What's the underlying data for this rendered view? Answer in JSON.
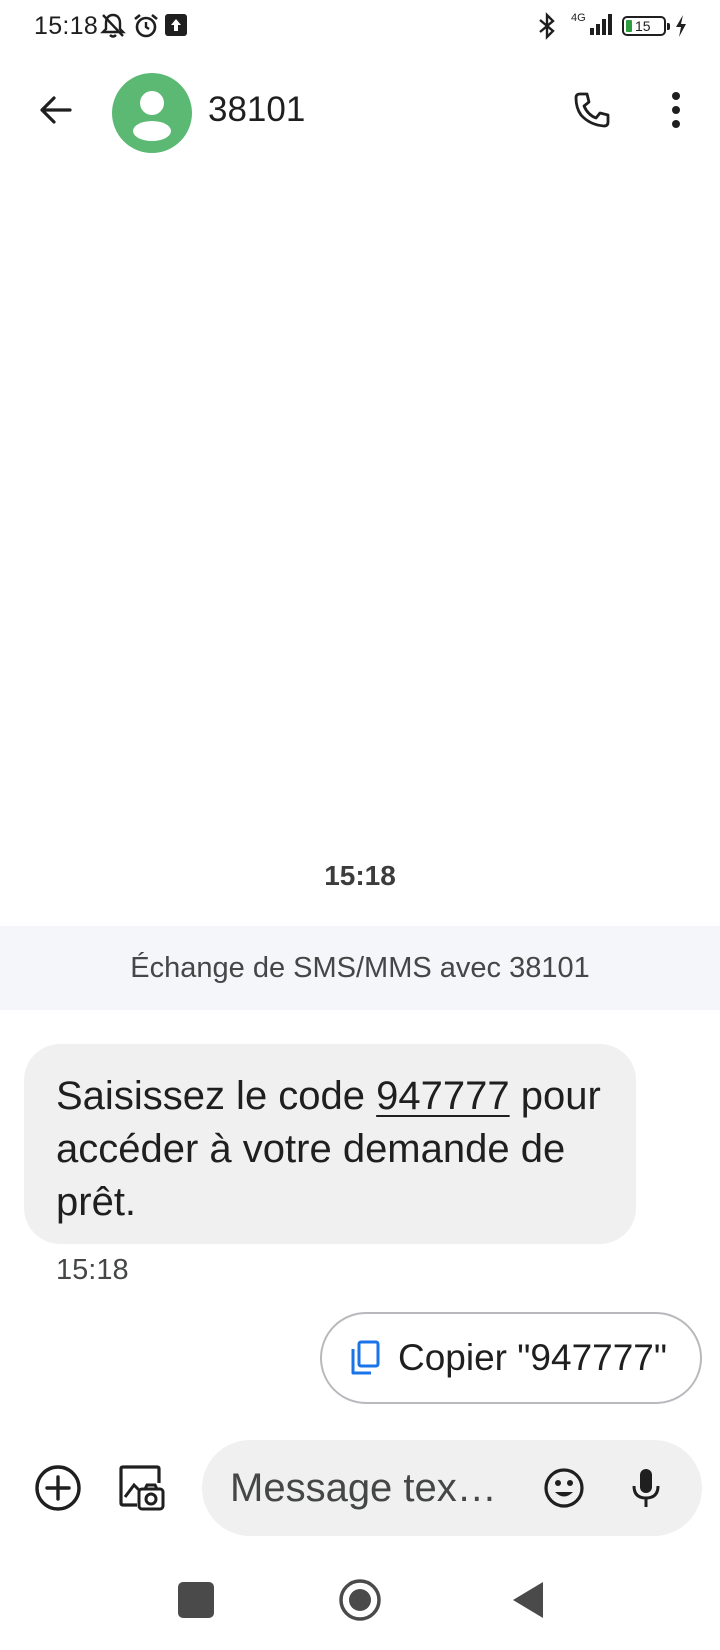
{
  "status_bar": {
    "time": "15:18",
    "battery_level": "15",
    "network": "4G",
    "icons": [
      "notifications-off-icon",
      "alarm-icon",
      "upload-icon",
      "bluetooth-icon",
      "signal-icon",
      "battery-icon",
      "charging-icon"
    ]
  },
  "app_bar": {
    "contact_name": "38101",
    "avatar_color": "#5bb974",
    "icons": [
      "back-arrow-icon",
      "phone-icon",
      "more-vert-icon"
    ]
  },
  "conversation": {
    "time_header": "15:18",
    "exchange_banner": "Échange de SMS/MMS avec 38101",
    "message": {
      "text_before": "Saisissez le code ",
      "code": "947777",
      "text_after": " pour accéder à votre demande de prêt.",
      "time": "15:18"
    },
    "copy_suggestion": "Copier \"947777\"",
    "copy_icon_color": "#1a73e8"
  },
  "compose": {
    "placeholder": "Message tex…",
    "icons": [
      "add-circle-icon",
      "gallery-icon",
      "emoji-icon",
      "mic-icon"
    ]
  },
  "nav_bar": {
    "icons": [
      "recents-icon",
      "home-icon",
      "back-triangle-icon"
    ]
  }
}
